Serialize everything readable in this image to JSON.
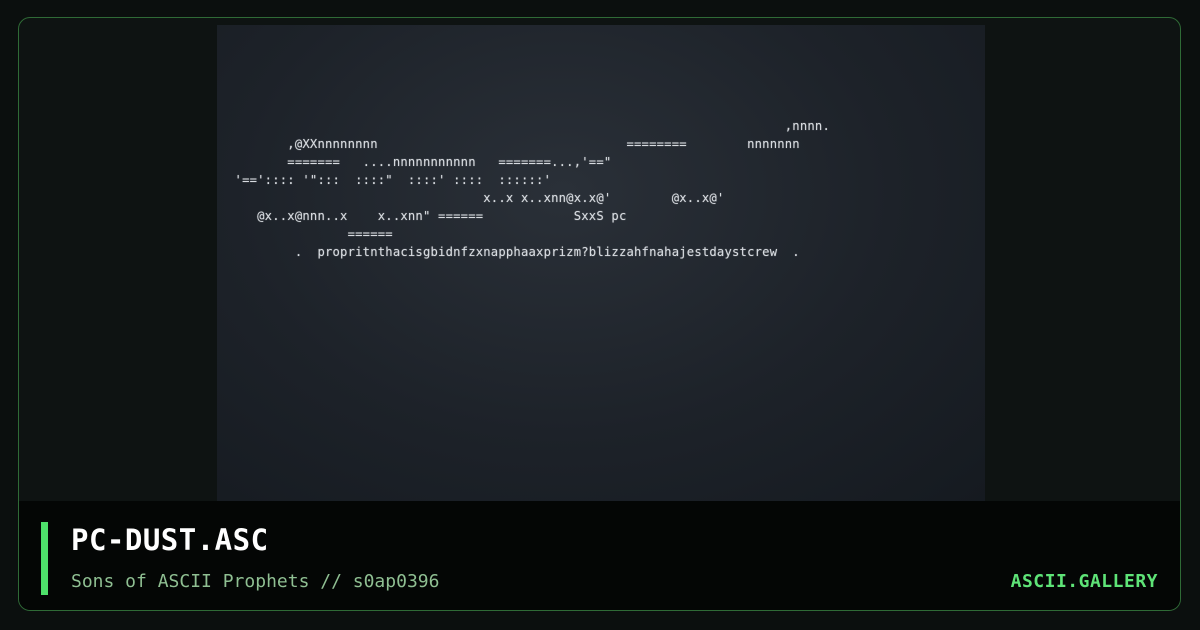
{
  "artwork": {
    "ascii_lines": [
      "                                                                          ,nnnn.",
      "        ,@XXnnnnnnnn                                 ========        nnnnnnn",
      "        =======   ....nnnnnnnnnnn   =======...,'==\"",
      " '==':::: '\":::  ::::\"  ::::' ::::  ::::::'",
      "                                  x..x x..xnn@x.x@'        @x..x@'",
      "    @x..x@nnn..x    x..xnn\" ======            SxxS pc",
      "                ======",
      "         .  propritnthacisgbidnfzxnapphaaxprizm?blizzahfnahajestdaystcrew  ."
    ]
  },
  "info": {
    "title": "PC-DUST.ASC",
    "subtitle": "Sons of ASCII Prophets // s0ap0396",
    "brand": "ASCII.GALLERY"
  },
  "colors": {
    "accent": "#4ee06a",
    "border": "#2f6a36",
    "subtitle": "#8fbf92",
    "brand": "#5ee377"
  }
}
